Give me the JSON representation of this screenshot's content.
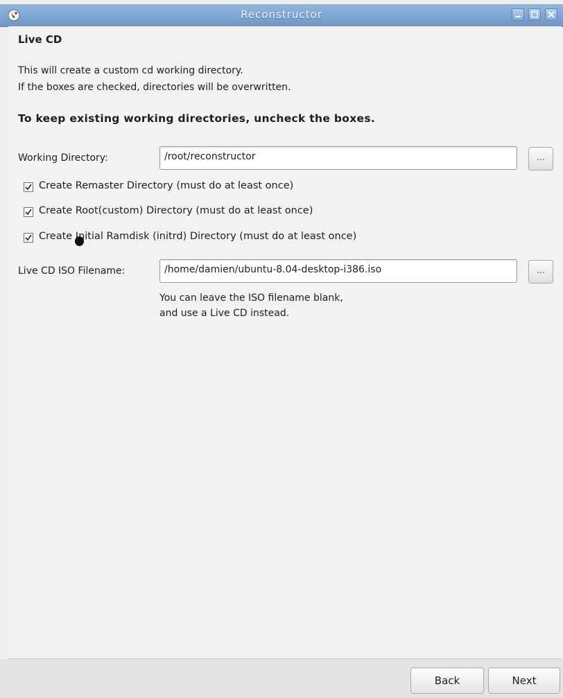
{
  "window": {
    "title": "Reconstructor"
  },
  "page": {
    "heading": "Live CD",
    "description_line1": "This will create a custom cd working directory.",
    "description_line2": "If the boxes are checked, directories will be overwritten.",
    "warning": "To keep existing working directories, uncheck the boxes."
  },
  "working_directory": {
    "label": "Working Directory:",
    "value": "/root/reconstructor",
    "browse_label": "..."
  },
  "checkboxes": [
    {
      "label": "Create Remaster Directory (must do at least once)",
      "checked": true
    },
    {
      "label": "Create Root(custom) Directory (must do at least once)",
      "checked": true
    },
    {
      "label": "Create Initial Ramdisk (initrd) Directory (must do at least once)",
      "checked": true
    }
  ],
  "iso": {
    "label": "Live CD ISO Filename:",
    "value": "/home/damien/ubuntu-8.04-desktop-i386.iso",
    "browse_label": "...",
    "hint_line1": "You can leave the ISO filename blank,",
    "hint_line2": "and use a Live CD instead."
  },
  "buttons": {
    "back": "Back",
    "next": "Next"
  },
  "colors": {
    "titlebar": "#7ea3d2",
    "background": "#f2f2f2"
  },
  "icons": [
    "app-icon",
    "minimize-icon",
    "maximize-icon",
    "close-icon",
    "checkmark-icon"
  ]
}
